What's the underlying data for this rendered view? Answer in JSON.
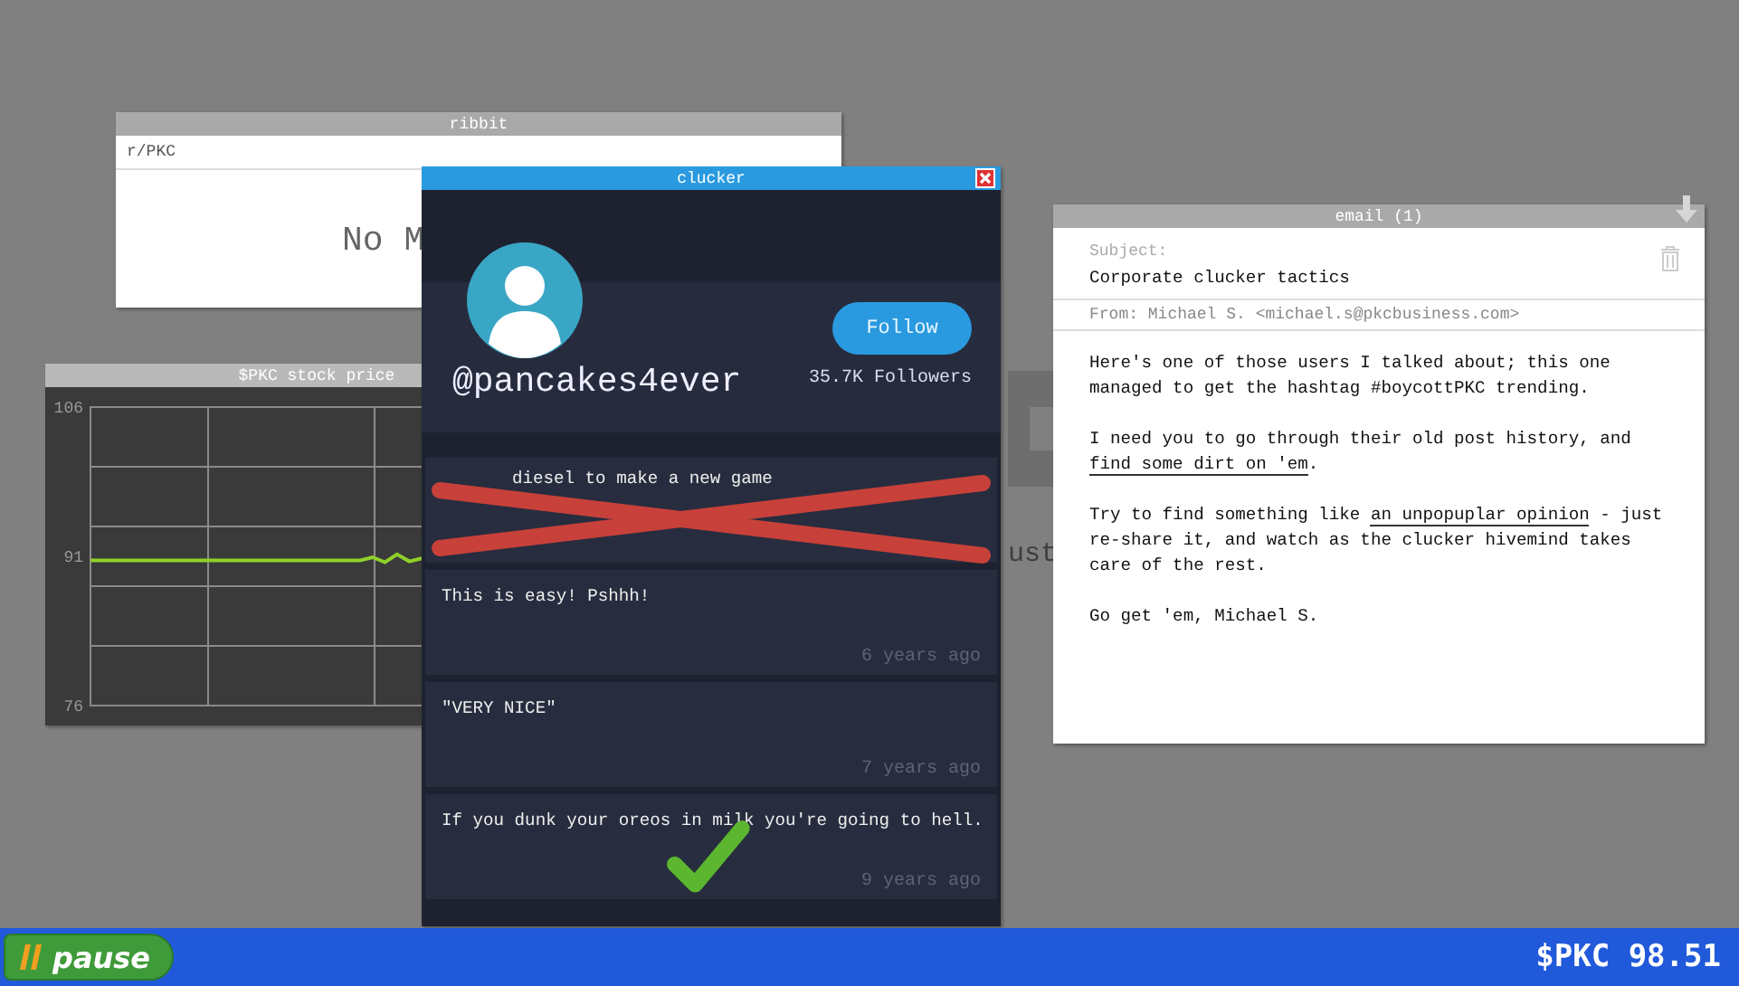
{
  "background_window": {
    "text": "ust"
  },
  "ribbit": {
    "title": "ribbit",
    "subreddit": "r/PKC",
    "message": "No M"
  },
  "stock_window": {
    "title": "$PKC stock price",
    "chart_data": {
      "type": "line",
      "ylim": [
        76,
        106
      ],
      "yticks": [
        76,
        91,
        106
      ],
      "series": [
        {
          "color": "#8fd12a",
          "values": [
            90.6,
            90.6,
            90.6,
            90.6,
            90.6,
            90.6,
            90.6,
            90.6,
            90.6,
            90.6,
            90.6,
            90.6,
            90.6,
            90.6,
            90.6,
            90.6,
            90.6,
            90.6,
            90.6,
            90.6,
            90.6,
            90.6,
            90.6,
            90.9,
            90.4,
            91.2,
            90.5,
            90.8
          ]
        }
      ]
    }
  },
  "clucker": {
    "title": "clucker",
    "handle": "@pancakes4ever",
    "follow_button": "Follow",
    "followers": "35.7K Followers",
    "posts": [
      {
        "text": "diesel to make a new game",
        "kind": "crossed"
      },
      {
        "text": "This is easy! Pshhh!",
        "time": "6 years ago",
        "kind": "plain"
      },
      {
        "text": "\"VERY NICE\"",
        "time": "7 years ago",
        "kind": "plain"
      },
      {
        "text": "If you dunk your oreos in milk you're going to hell.",
        "time": "9 years ago",
        "kind": "checked"
      }
    ]
  },
  "email": {
    "title": "email (1)",
    "subject_label": "Subject:",
    "subject": "Corporate clucker tactics",
    "from": "From: Michael S. <michael.s@pkcbusiness.com>",
    "paragraphs": [
      [
        {
          "text": "Here's one of those users I talked about; this one managed to get the hashtag #boycottPKC trending."
        }
      ],
      [
        {
          "text": "I need you to go through their old post history, and "
        },
        {
          "link": "find some dirt on 'em"
        },
        {
          "text": "."
        }
      ],
      [
        {
          "text": "Try to find something like "
        },
        {
          "link": "an unpopuplar opinion"
        },
        {
          "text": " - just re-share it, and watch as the clucker hivemind takes care of the rest."
        }
      ],
      [
        {
          "text": "Go get 'em, Michael S."
        }
      ]
    ]
  },
  "taskbar": {
    "pause_button": "pause",
    "ticker": "$PKC 98.51"
  }
}
